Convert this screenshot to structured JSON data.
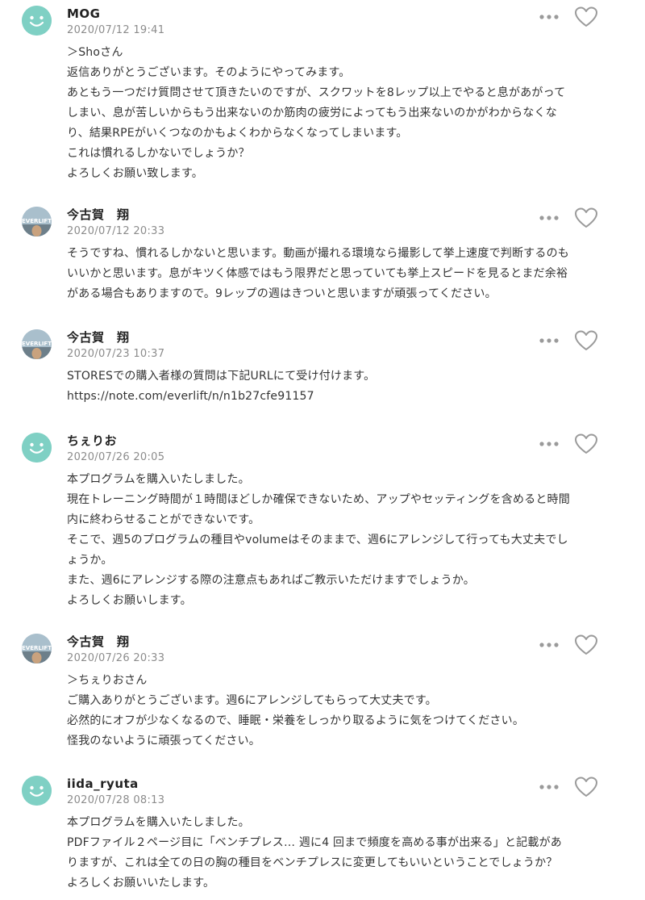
{
  "comments": [
    {
      "author": "MOG",
      "date": "2020/07/12 19:41",
      "lines": [
        "＞Shoさん",
        "返信ありがとうございます。そのようにやってみます。",
        "あともう一つだけ質問させて頂きたいのですが、スクワットを8レップ以上でやると息があがって",
        "しまい、息が苦しいからもう出来ないのか筋肉の疲労によってもう出来ないのかがわからなくな",
        "り、結果RPEがいくつなのかもよくわからなくなってしまいます。",
        "これは慣れるしかないでしょうか？",
        "よろしくお願い致します。"
      ]
    },
    {
      "author": "今古賀　翔",
      "date": "2020/07/12 20:33",
      "lines": [
        "そうですね、慣れるしかないと思います。動画が撮れる環境なら撮影して挙上速度で判断するのも",
        "いいかと思います。息がキツく体感ではもう限界だと思っていても挙上スピードを見るとまだ余裕",
        "がある場合もありますので。9レップの週はきついと思いますが頑張ってください。"
      ]
    },
    {
      "author": "今古賀　翔",
      "date": "2020/07/23 10:37",
      "lines": [
        "STORESでの購入者様の質問は下記URLにて受け付けます。",
        "https://note.com/everlift/n/n1b27cfe91157"
      ]
    },
    {
      "author": "ちぇりお",
      "date": "2020/07/26 20:05",
      "lines": [
        "本プログラムを購入いたしました。",
        "現在トレーニング時間が１時間ほどしか確保できないため、アップやセッティングを含めると時間",
        "内に終わらせることができないです。",
        "そこで、週5のプログラムの種目やvolumeはそのままで、週6にアレンジして行っても大丈夫でし",
        "ょうか。",
        "また、週6にアレンジする際の注意点もあればご教示いただけますでしょうか。",
        "よろしくお願いします。"
      ]
    },
    {
      "author": "今古賀　翔",
      "date": "2020/07/26 20:33",
      "lines": [
        "＞ちぇりおさん",
        "ご購入ありがとうございます。週6にアレンジしてもらって大丈夫です。",
        "必然的にオフが少なくなるので、睡眠・栄養をしっかり取るように気をつけてください。",
        "怪我のないように頑張ってください。"
      ]
    },
    {
      "author": "iida_ryuta",
      "date": "2020/07/28 08:13",
      "lines": [
        "本プログラムを購入いたしました。",
        "PDFファイル２ページ目に「ベンチプレス… 週に4 回まで頻度を高める事が出来る」と記載があ",
        "りますが、これは全ての日の胸の種目をベンチプレスに変更してもいいということでしょうか？",
        "よろしくお願いいたします。"
      ]
    }
  ],
  "icons": {
    "more": "more-dots-icon",
    "like": "heart-outline-icon",
    "default_avatar": "smiley-face-icon",
    "brand_avatar": "everlift-avatar"
  },
  "avatar_text": "EVERLIFT",
  "colors": {
    "avatar_mint": "#7fd0c4",
    "muted_text": "#8c8c8c",
    "icon_gray": "#9a9a9a",
    "body_text": "#333333"
  }
}
